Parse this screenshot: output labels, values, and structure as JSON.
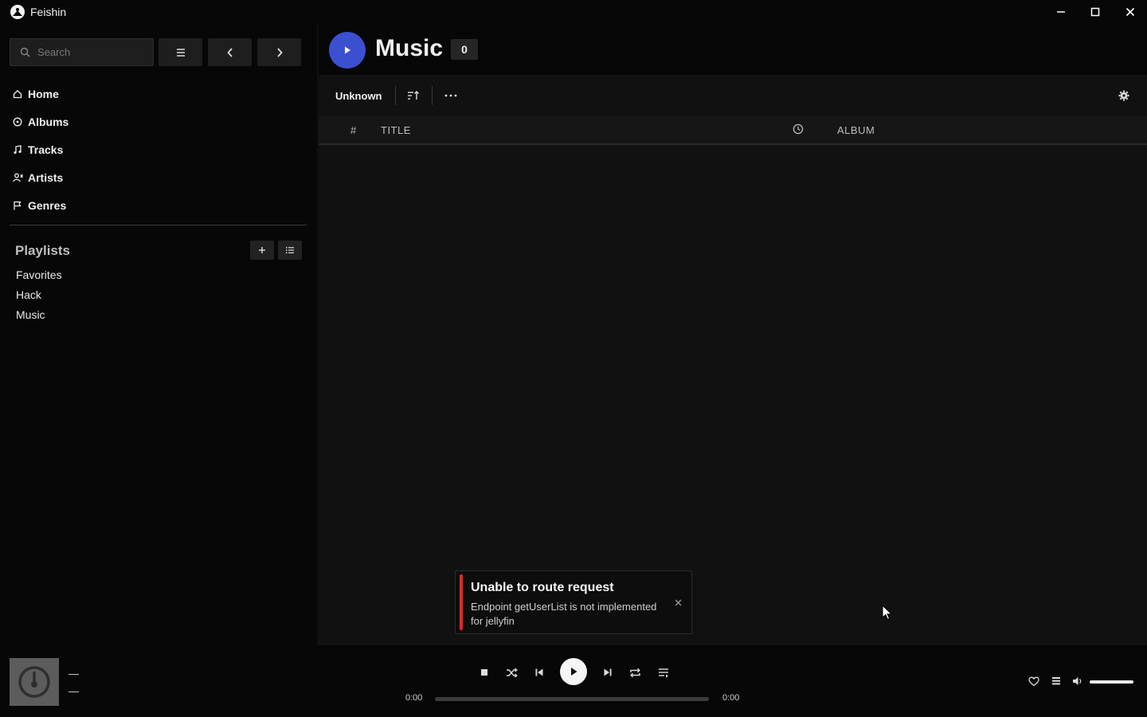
{
  "window": {
    "title": "Feishin"
  },
  "sidebar": {
    "search_placeholder": "Search",
    "nav": [
      {
        "label": "Home",
        "icon": "home-icon"
      },
      {
        "label": "Albums",
        "icon": "disc-icon"
      },
      {
        "label": "Tracks",
        "icon": "music-note-icon"
      },
      {
        "label": "Artists",
        "icon": "users-icon"
      },
      {
        "label": "Genres",
        "icon": "flag-icon"
      }
    ],
    "playlists_heading": "Playlists",
    "playlists": [
      "Favorites",
      "Hack",
      "Music"
    ]
  },
  "main": {
    "title": "Music",
    "count": "0",
    "filter_label": "Unknown",
    "columns": {
      "number": "#",
      "title": "TITLE",
      "duration_icon": "clock-icon",
      "album": "ALBUM"
    }
  },
  "toast": {
    "title": "Unable to route request",
    "message": "Endpoint getUserList is not implemented for jellyfin",
    "accent_color": "#e02a2a"
  },
  "player": {
    "track_title": "—",
    "track_artist": "—",
    "time_elapsed": "0:00",
    "time_total": "0:00",
    "progress": 0,
    "volume": 1.0
  },
  "colors": {
    "accent": "#3b4fd1",
    "background": "#0f0f0f",
    "sidebar": "#070707"
  }
}
